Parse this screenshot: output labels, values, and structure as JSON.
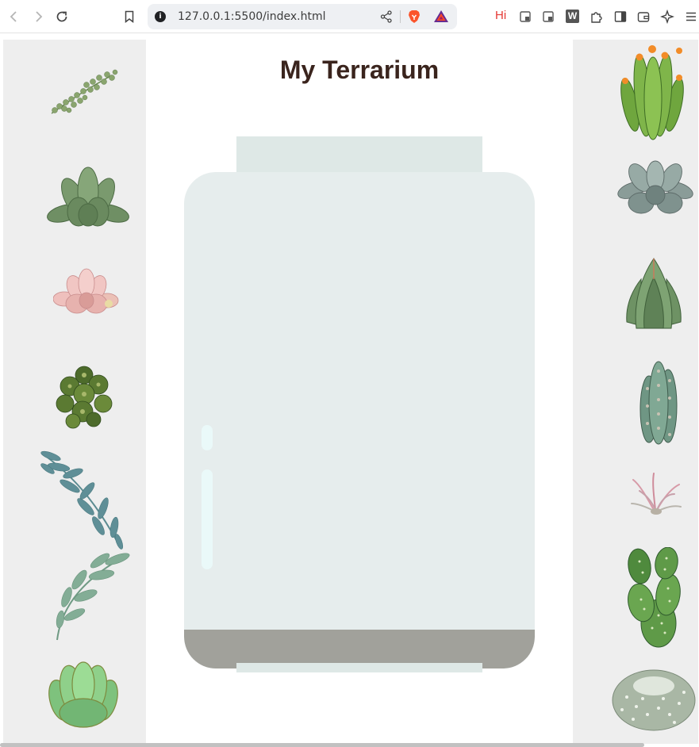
{
  "browser": {
    "url": "127.0.0.1:5500/index.html",
    "extension_badge_hi": "Hi",
    "extension_badge_w": "W",
    "icons": [
      "back-icon",
      "forward-icon",
      "reload-icon",
      "bookmark-icon",
      "site-info-icon",
      "share-icon",
      "brave-shields-icon",
      "brave-rewards-icon",
      "extension-icon",
      "reader-icon",
      "extensions-puzzle-icon",
      "sidebar-icon",
      "wallet-icon",
      "leo-ai-icon",
      "menu-icon"
    ]
  },
  "page": {
    "title": "My Terrarium"
  },
  "plants": {
    "left": [
      "plant-1",
      "plant-2",
      "plant-3",
      "plant-4",
      "plant-5",
      "plant-6",
      "plant-7"
    ],
    "right": [
      "plant-8",
      "plant-9",
      "plant-10",
      "plant-11",
      "plant-12",
      "plant-13",
      "plant-14"
    ]
  },
  "colors": {
    "title": "#3a241d",
    "plant_holder": "#eeeeee",
    "jar_walls": "#e6eded",
    "jar_top": "#dee8e6",
    "dirt": "#a1a19b",
    "glossy": "#eaf9f9"
  }
}
